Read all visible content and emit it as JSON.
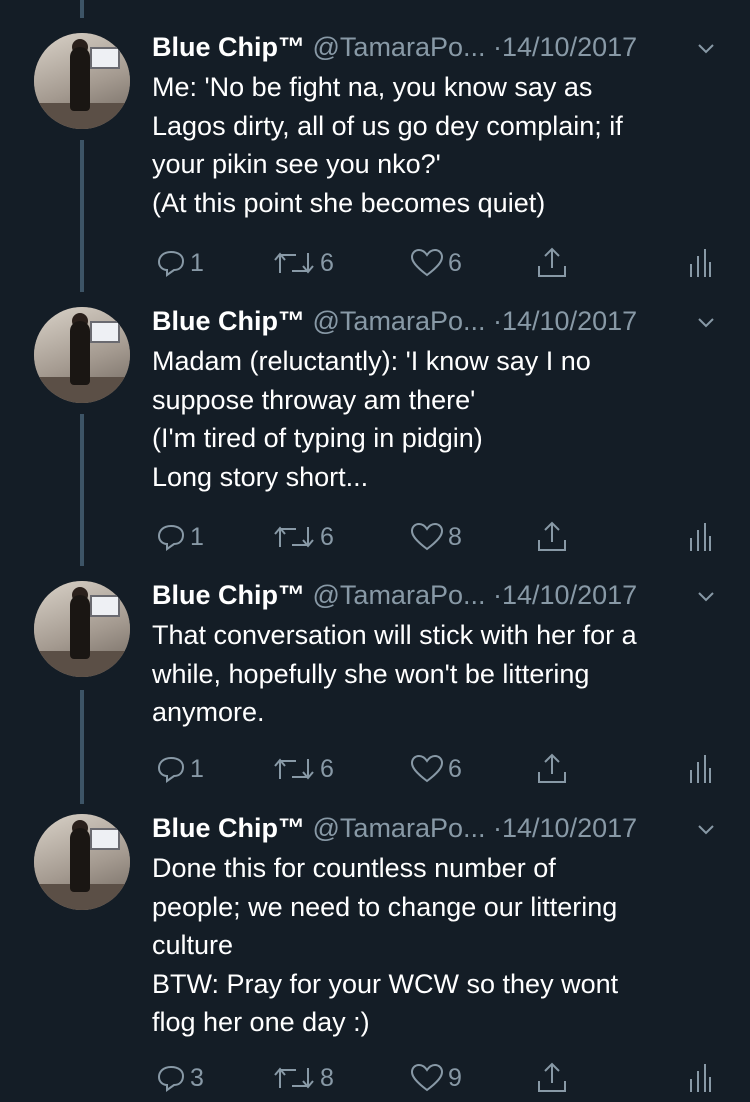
{
  "tweets": [
    {
      "name": "Blue Chip™",
      "handle": "@TamaraPo...",
      "sep": "·",
      "date": "14/10/2017",
      "lines": [
        "Me: 'No be fight na, you know say as",
        "Lagos dirty, all of us go dey complain; if",
        "your pikin see you nko?'",
        "(At this point she becomes quiet)"
      ],
      "replies": "1",
      "retweets": "6",
      "likes": "6"
    },
    {
      "name": "Blue Chip™",
      "handle": "@TamaraPo...",
      "sep": "·",
      "date": "14/10/2017",
      "lines": [
        "Madam (reluctantly): 'I know say I no",
        "suppose throway am there'",
        "(I'm tired of typing in pidgin)",
        "Long story short..."
      ],
      "replies": "1",
      "retweets": "6",
      "likes": "8"
    },
    {
      "name": "Blue Chip™",
      "handle": "@TamaraPo...",
      "sep": "·",
      "date": "14/10/2017",
      "lines": [
        "That conversation will stick with her for a",
        "while, hopefully she won't be littering",
        "anymore."
      ],
      "replies": "1",
      "retweets": "6",
      "likes": "6"
    },
    {
      "name": "Blue Chip™",
      "handle": "@TamaraPo...",
      "sep": "·",
      "date": "14/10/2017",
      "lines": [
        "Done this for countless number of",
        "people; we need to change our littering",
        "culture",
        "BTW: Pray for your WCW so they wont",
        "flog her one day :)"
      ],
      "replies": "3",
      "retweets": "8",
      "likes": "9"
    }
  ],
  "colors": {
    "background": "#141d26",
    "muted": "#8899a6",
    "thread_line": "#3d5466"
  },
  "icons": [
    "reply-icon",
    "retweet-icon",
    "like-icon",
    "share-icon",
    "analytics-icon",
    "chevron-down-icon"
  ]
}
